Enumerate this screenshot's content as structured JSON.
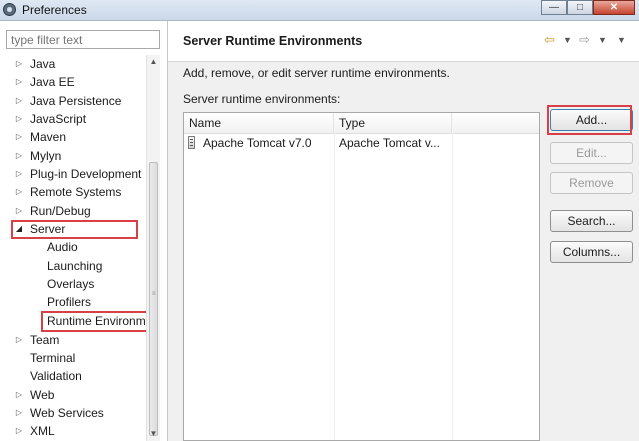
{
  "window": {
    "title": "Preferences"
  },
  "filter": {
    "placeholder": "type filter text"
  },
  "tree": [
    {
      "label": "Java",
      "collapsed": true
    },
    {
      "label": "Java EE",
      "collapsed": true
    },
    {
      "label": "Java Persistence",
      "collapsed": true
    },
    {
      "label": "JavaScript",
      "collapsed": true
    },
    {
      "label": "Maven",
      "collapsed": true
    },
    {
      "label": "Mylyn",
      "collapsed": true
    },
    {
      "label": "Plug-in Development",
      "collapsed": true
    },
    {
      "label": "Remote Systems",
      "collapsed": true
    },
    {
      "label": "Run/Debug",
      "collapsed": true
    },
    {
      "label": "Server",
      "expanded": true
    },
    {
      "label": "Audio"
    },
    {
      "label": "Launching"
    },
    {
      "label": "Overlays"
    },
    {
      "label": "Profilers"
    },
    {
      "label": "Runtime Environm",
      "selected": true
    },
    {
      "label": "Team",
      "collapsed": true
    },
    {
      "label": "Terminal"
    },
    {
      "label": "Validation"
    },
    {
      "label": "Web",
      "collapsed": true
    },
    {
      "label": "Web Services",
      "collapsed": true
    },
    {
      "label": "XML",
      "collapsed": true
    }
  ],
  "page": {
    "title": "Server Runtime Environments",
    "description": "Add, remove, or edit server runtime environments.",
    "table_label": "Server runtime environments:",
    "columns": [
      "Name",
      "Type"
    ],
    "rows": [
      {
        "name": "Apache Tomcat v7.0",
        "type": "Apache Tomcat v..."
      }
    ]
  },
  "buttons": {
    "add": "Add...",
    "edit": "Edit...",
    "remove": "Remove",
    "search": "Search...",
    "columns": "Columns..."
  },
  "colors": {
    "highlight": "#d64046"
  }
}
